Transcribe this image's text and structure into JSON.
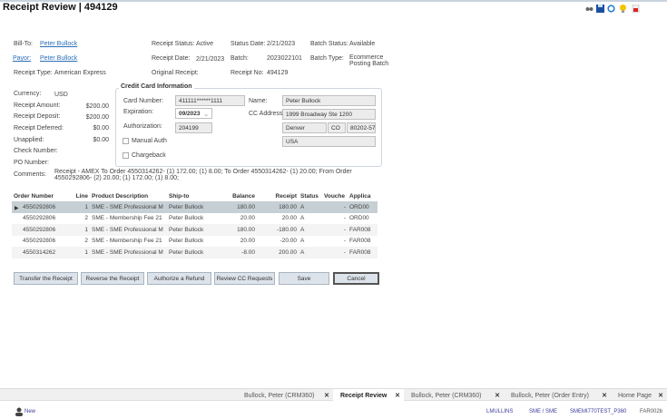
{
  "header": {
    "title": "Receipt Review  |  494129",
    "toolbar_icons": [
      "glasses-icon",
      "save-icon",
      "refresh-icon",
      "lightbulb-icon",
      "pdf-icon"
    ]
  },
  "receipt": {
    "bill_to_label": "Bill-To:",
    "bill_to": "Peter Bullock",
    "payor_label": "Payor:",
    "payor": "Peter Bullock",
    "receipt_type_label": "Receipt Type:",
    "receipt_type": "American Express",
    "receipt_status_label": "Receipt Status:",
    "receipt_status": "Active",
    "receipt_date_label": "Receipt Date:",
    "receipt_date": "2/21/2023",
    "original_receipt_label": "Original Receipt:",
    "status_date_label": "Status Date:",
    "status_date": "2/21/2023",
    "batch_label": "Batch:",
    "batch": "2023022101",
    "receipt_no_label": "Receipt No:",
    "receipt_no": "494129",
    "batch_status_label": "Batch Status:",
    "batch_status": "Available",
    "batch_type_label": "Batch Type:",
    "batch_type_1": "Ecommerce",
    "batch_type_2": "Posting Batch",
    "currency_label": "Currency:",
    "currency": "USD",
    "amount_label": "Receipt Amount:",
    "amount": "$200.00",
    "deposit_label": "Receipt Deposit:",
    "deposit": "$200.00",
    "deferred_label": "Receipt Deferred:",
    "deferred": "$0.00",
    "unapplied_label": "Unapplied:",
    "unapplied": "$0.00",
    "check_label": "Check Number:",
    "po_label": "PO Number:",
    "comments_label": "Comments:",
    "comments_1": "Receipt - AMEX To Order 4550314262- (1) 172.00;  (1) 8.00;  To Order 4550314262- (1) 20.00;  From Order",
    "comments_2": "4550292806- (2) 20.00;  (1) 172.00;  (1) 8.00;"
  },
  "cc": {
    "title": "Credit Card Information",
    "card_number_label": "Card Number:",
    "card_number": "411111******1111",
    "expiration_label": "Expiration:",
    "expiration": "09/2023",
    "authorization_label": "Authorization:",
    "authorization": "204199",
    "manual_auth": "Manual Auth",
    "manual_auth_checked": false,
    "chargeback": "Chargeback",
    "chargeback_checked": false,
    "name_label": "Name:",
    "name": "Peter Bullock",
    "address_label": "CC Address:",
    "address": "1999 Broadway Ste 1200",
    "city": "Denver",
    "state": "CO",
    "zip": "80202-573",
    "country": "USA"
  },
  "table": {
    "headers": [
      "Order Number",
      "Line",
      "Product Description",
      "Ship-to",
      "Balance",
      "Receipt",
      "Status",
      "Vouche",
      "Applica"
    ],
    "rows": [
      [
        "4550292806",
        "1",
        "SME - SME Professional M",
        "Peter Bullock",
        "180.00",
        "180.00",
        "A",
        "-",
        "ORD00"
      ],
      [
        "4550292806",
        "2",
        "SME -  Membership Fee 21",
        "Peter Bullock",
        "20.00",
        "20.00",
        "A",
        "-",
        "ORD00"
      ],
      [
        "4550292806",
        "1",
        "SME - SME Professional M",
        "Peter Bullock",
        "180.00",
        "-180.00",
        "A",
        "-",
        "FAR008"
      ],
      [
        "4550292806",
        "2",
        "SME -  Membership Fee 21",
        "Peter Bullock",
        "20.00",
        "-20.00",
        "A",
        "-",
        "FAR008"
      ],
      [
        "4550314262",
        "1",
        "SME - SME Professional M",
        "Peter Bullock",
        "-8.00",
        "200.00",
        "A",
        "-",
        "FAR008"
      ]
    ]
  },
  "buttons": {
    "transfer": "Transfer the Receipt",
    "reverse": "Reverse the Receipt",
    "refund": "Authorize a Refund",
    "review": "Review CC Requests",
    "save": "Save",
    "cancel": "Cancel"
  },
  "tabs": [
    {
      "label": "Bullock, Peter (CRM360)"
    },
    {
      "label": "Receipt Review",
      "active": true
    },
    {
      "label": "Bullock, Peter (CRM360)"
    },
    {
      "label": "Bullock, Peter (Order Entry)"
    },
    {
      "label": "Home Page"
    }
  ],
  "status": {
    "new": "New",
    "user": "LMULLINS",
    "org": "SME / SME",
    "env": "SMEMI770TEST_P360",
    "form": "FAR002b"
  }
}
